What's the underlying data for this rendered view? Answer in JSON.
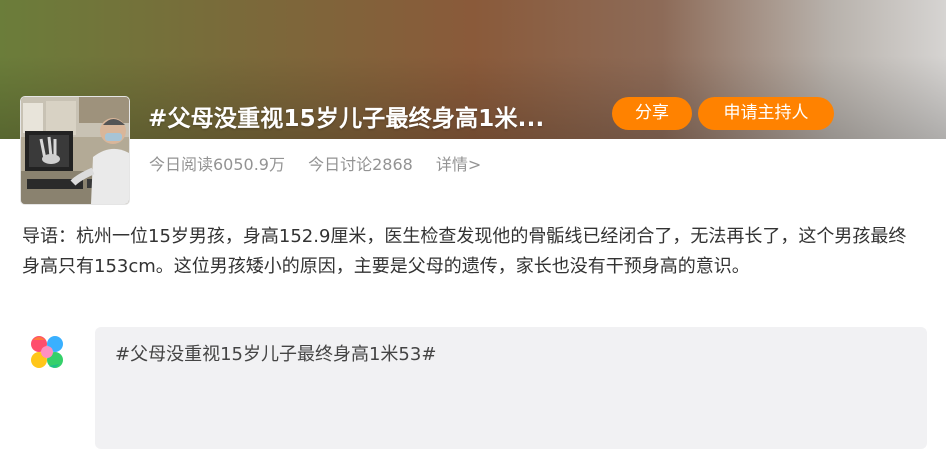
{
  "topic": {
    "title": "#父母没重视15岁儿子最终身高1米...",
    "share_label": "分享",
    "apply_host_label": "申请主持人",
    "stats": {
      "reads": "今日阅读6050.9万",
      "discussions": "今日讨论2868",
      "detail_link": "详情>"
    },
    "intro": "导语：杭州一位15岁男孩，身高152.9厘米，医生检查发现他的骨骺线已经闭合了，无法再长了，这个男孩最终身高只有153cm。这位男孩矮小的原因，主要是父母的遗传，家长也没有干预身高的意识。"
  },
  "composer": {
    "text": "#父母没重视15岁儿子最终身高1米53#"
  },
  "icons": {
    "thumbnail": "doctor-xray-photo",
    "logo": "weibo-flower-logo"
  },
  "colors": {
    "accent": "#ff8200",
    "muted_text": "#939393",
    "body_text": "#333333",
    "input_bg": "#f1f1f3"
  }
}
